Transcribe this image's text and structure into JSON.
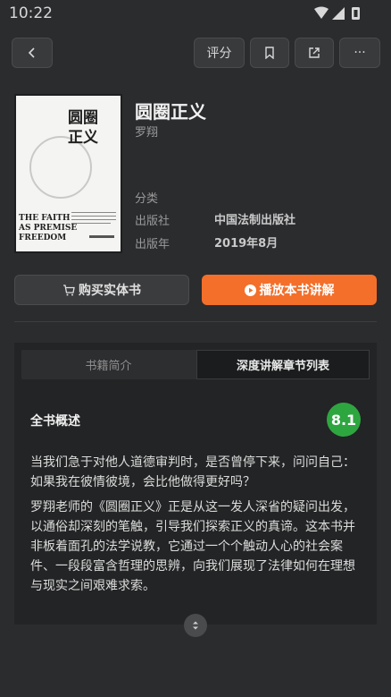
{
  "status_bar": {
    "time": "10:22"
  },
  "header": {
    "back_icon": "chevron-left-icon",
    "rate_label": "评分",
    "bookmark_icon": "bookmark-icon",
    "share_icon": "share-icon",
    "more_label": "···"
  },
  "book": {
    "title": "圆圈正义",
    "author": "罗翔",
    "cover_title": "圆圈\n正义",
    "cover_subtitle_en": "THE FAITH AS PREMISE OF FREEDOM",
    "meta": [
      {
        "label": "分类",
        "value": ""
      },
      {
        "label": "出版社",
        "value": "中国法制出版社"
      },
      {
        "label": "出版年",
        "value": "2019年8月"
      }
    ]
  },
  "actions": {
    "buy_label": "购买实体书",
    "play_label": "播放本书讲解",
    "accent_color": "#f36f2a"
  },
  "tabs": [
    {
      "label": "书籍简介",
      "active": false
    },
    {
      "label": "深度讲解章节列表",
      "active": true
    }
  ],
  "overview": {
    "title": "全书概述",
    "score": "8.1",
    "score_color": "#2ea640",
    "paragraphs": [
      "当我们急于对他人道德审判时，是否曾停下来，问问自己：如果我在彼情彼境，会比他做得更好吗？",
      "罗翔老师的《圆圈正义》正是从这一发人深省的疑问出发，以通俗却深刻的笔触，引导我们探索正义的真谛。这本书并非板着面孔的法学说教，它通过一个个触动人心的社会案件、一段段富含哲理的思辨，向我们展现了法律如何在理想与现实之间艰难求索。"
    ]
  }
}
